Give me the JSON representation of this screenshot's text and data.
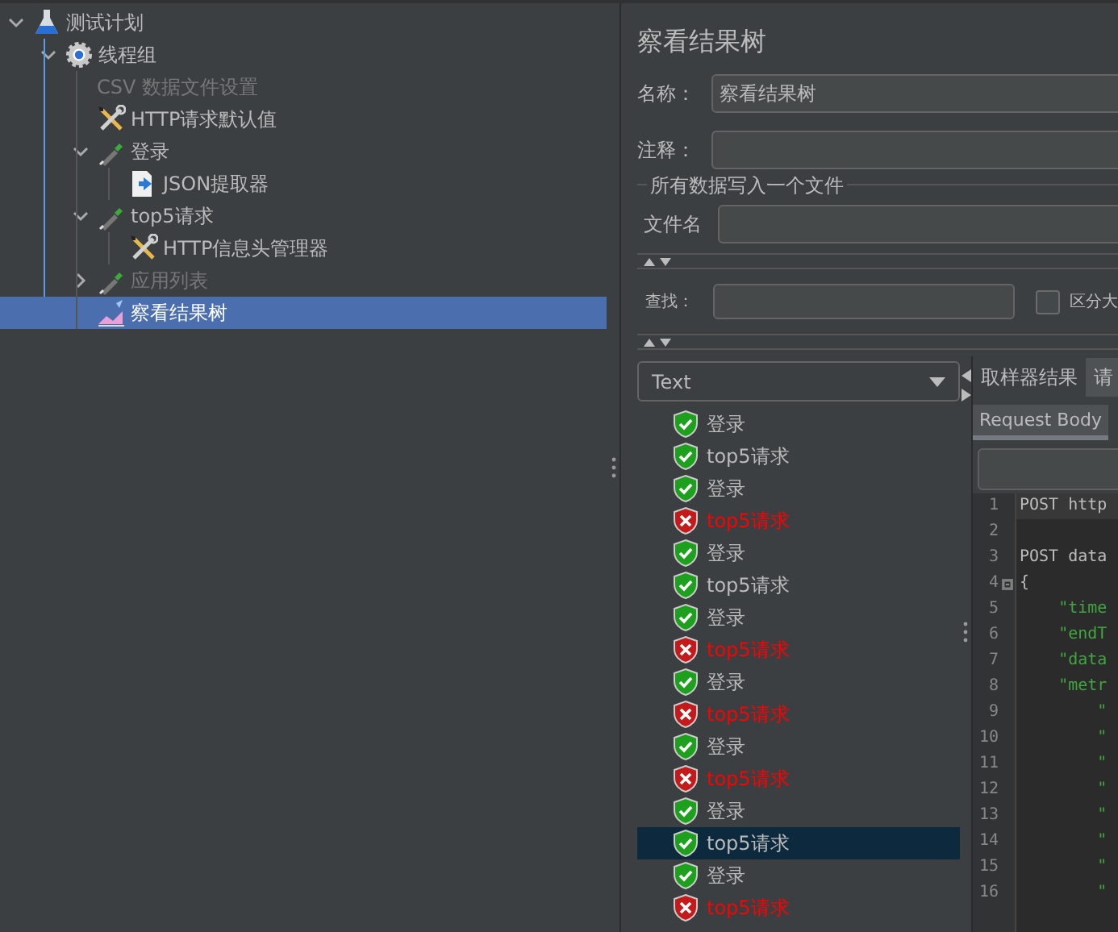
{
  "tree": [
    {
      "label": "测试计划",
      "kind": "plan",
      "expanded": true,
      "disabled": false,
      "selected": false,
      "children": [
        {
          "label": "线程组",
          "kind": "group",
          "expanded": true,
          "disabled": false,
          "selected": false,
          "children": [
            {
              "label": "CSV 数据文件设置",
              "kind": "blank",
              "disabled": true,
              "selected": false
            },
            {
              "label": "HTTP请求默认值",
              "kind": "config",
              "disabled": false,
              "selected": false
            },
            {
              "label": "登录",
              "kind": "sampler",
              "expanded": true,
              "disabled": false,
              "selected": false,
              "children": [
                {
                  "label": "JSON提取器",
                  "kind": "extractor",
                  "disabled": false,
                  "selected": false
                }
              ]
            },
            {
              "label": "top5请求",
              "kind": "sampler",
              "expanded": true,
              "disabled": false,
              "selected": false,
              "children": [
                {
                  "label": "HTTP信息头管理器",
                  "kind": "config",
                  "disabled": false,
                  "selected": false
                }
              ]
            },
            {
              "label": "应用列表",
              "kind": "sampler",
              "expanded": false,
              "disabled": true,
              "selected": false
            },
            {
              "label": "察看结果树",
              "kind": "listener",
              "disabled": false,
              "selected": true
            }
          ]
        }
      ]
    }
  ],
  "panel": {
    "title": "察看结果树",
    "name_label": "名称：",
    "name_value": "察看结果树",
    "comment_label": "注释：",
    "file_group": "所有数据写入一个文件",
    "file_label": "文件名",
    "search_label": "查找：",
    "case_checkbox": {
      "label": "区分大",
      "checked": false
    }
  },
  "renderer": {
    "value": "Text"
  },
  "results": [
    {
      "label": "登录",
      "success": true,
      "selected": false
    },
    {
      "label": "top5请求",
      "success": true,
      "selected": false
    },
    {
      "label": "登录",
      "success": true,
      "selected": false
    },
    {
      "label": "top5请求",
      "success": false,
      "selected": false
    },
    {
      "label": "登录",
      "success": true,
      "selected": false
    },
    {
      "label": "top5请求",
      "success": true,
      "selected": false
    },
    {
      "label": "登录",
      "success": true,
      "selected": false
    },
    {
      "label": "top5请求",
      "success": false,
      "selected": false
    },
    {
      "label": "登录",
      "success": true,
      "selected": false
    },
    {
      "label": "top5请求",
      "success": false,
      "selected": false
    },
    {
      "label": "登录",
      "success": true,
      "selected": false
    },
    {
      "label": "top5请求",
      "success": false,
      "selected": false
    },
    {
      "label": "登录",
      "success": true,
      "selected": false
    },
    {
      "label": "top5请求",
      "success": true,
      "selected": true
    },
    {
      "label": "登录",
      "success": true,
      "selected": false
    },
    {
      "label": "top5请求",
      "success": false,
      "selected": false
    }
  ],
  "detail": {
    "tabs": [
      {
        "label": "取样器结果",
        "selected": false
      },
      {
        "label": "请",
        "selected": true
      }
    ],
    "subtabs": [
      {
        "label": "Request Body",
        "selected": true
      }
    ],
    "code": [
      {
        "number": "1",
        "text": "POST http",
        "kind": "plain",
        "current": true,
        "fold": false
      },
      {
        "number": "2",
        "kind": "plain",
        "current": false,
        "fold": false
      },
      {
        "number": "3",
        "text": "POST data",
        "kind": "plain",
        "current": false,
        "fold": false
      },
      {
        "number": "4",
        "text": "{",
        "kind": "plain",
        "current": false,
        "fold": true
      },
      {
        "number": "5",
        "text": "    \"time",
        "kind": "key",
        "current": false,
        "fold": false
      },
      {
        "number": "6",
        "text": "    \"endT",
        "kind": "key",
        "current": false,
        "fold": false
      },
      {
        "number": "7",
        "text": "    \"data",
        "kind": "key",
        "current": false,
        "fold": false
      },
      {
        "number": "8",
        "text": "    \"metr",
        "kind": "key",
        "current": false,
        "fold": false
      },
      {
        "number": "9",
        "text": "        \"",
        "kind": "key",
        "current": false,
        "fold": false
      },
      {
        "number": "10",
        "text": "        \"",
        "kind": "key",
        "current": false,
        "fold": false
      },
      {
        "number": "11",
        "text": "        \"",
        "kind": "key",
        "current": false,
        "fold": false
      },
      {
        "number": "12",
        "text": "        \"",
        "kind": "key",
        "current": false,
        "fold": false
      },
      {
        "number": "13",
        "text": "        \"",
        "kind": "key",
        "current": false,
        "fold": false
      },
      {
        "number": "14",
        "text": "        \"",
        "kind": "key",
        "current": false,
        "fold": false
      },
      {
        "number": "15",
        "text": "        \"",
        "kind": "key",
        "current": false,
        "fold": false
      },
      {
        "number": "16",
        "text": "        \"",
        "kind": "key",
        "current": false,
        "fold": false
      }
    ]
  }
}
